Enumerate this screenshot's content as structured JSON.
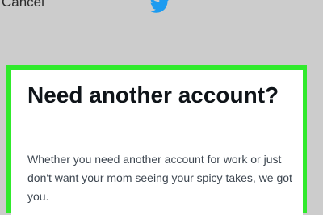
{
  "header": {
    "cancel_label": "Cancel",
    "logo_icon": "twitter-bird-icon",
    "logo_color": "#1d9bf0"
  },
  "card": {
    "title": "Need another account?",
    "body": "Whether you need another account for work or just don't want your mom seeing your spicy takes, we got you."
  },
  "colors": {
    "background": "#cccccc",
    "highlight": "#30ea2c",
    "card": "#ffffff",
    "title_text": "#0f1419",
    "body_text": "#3d4650"
  }
}
